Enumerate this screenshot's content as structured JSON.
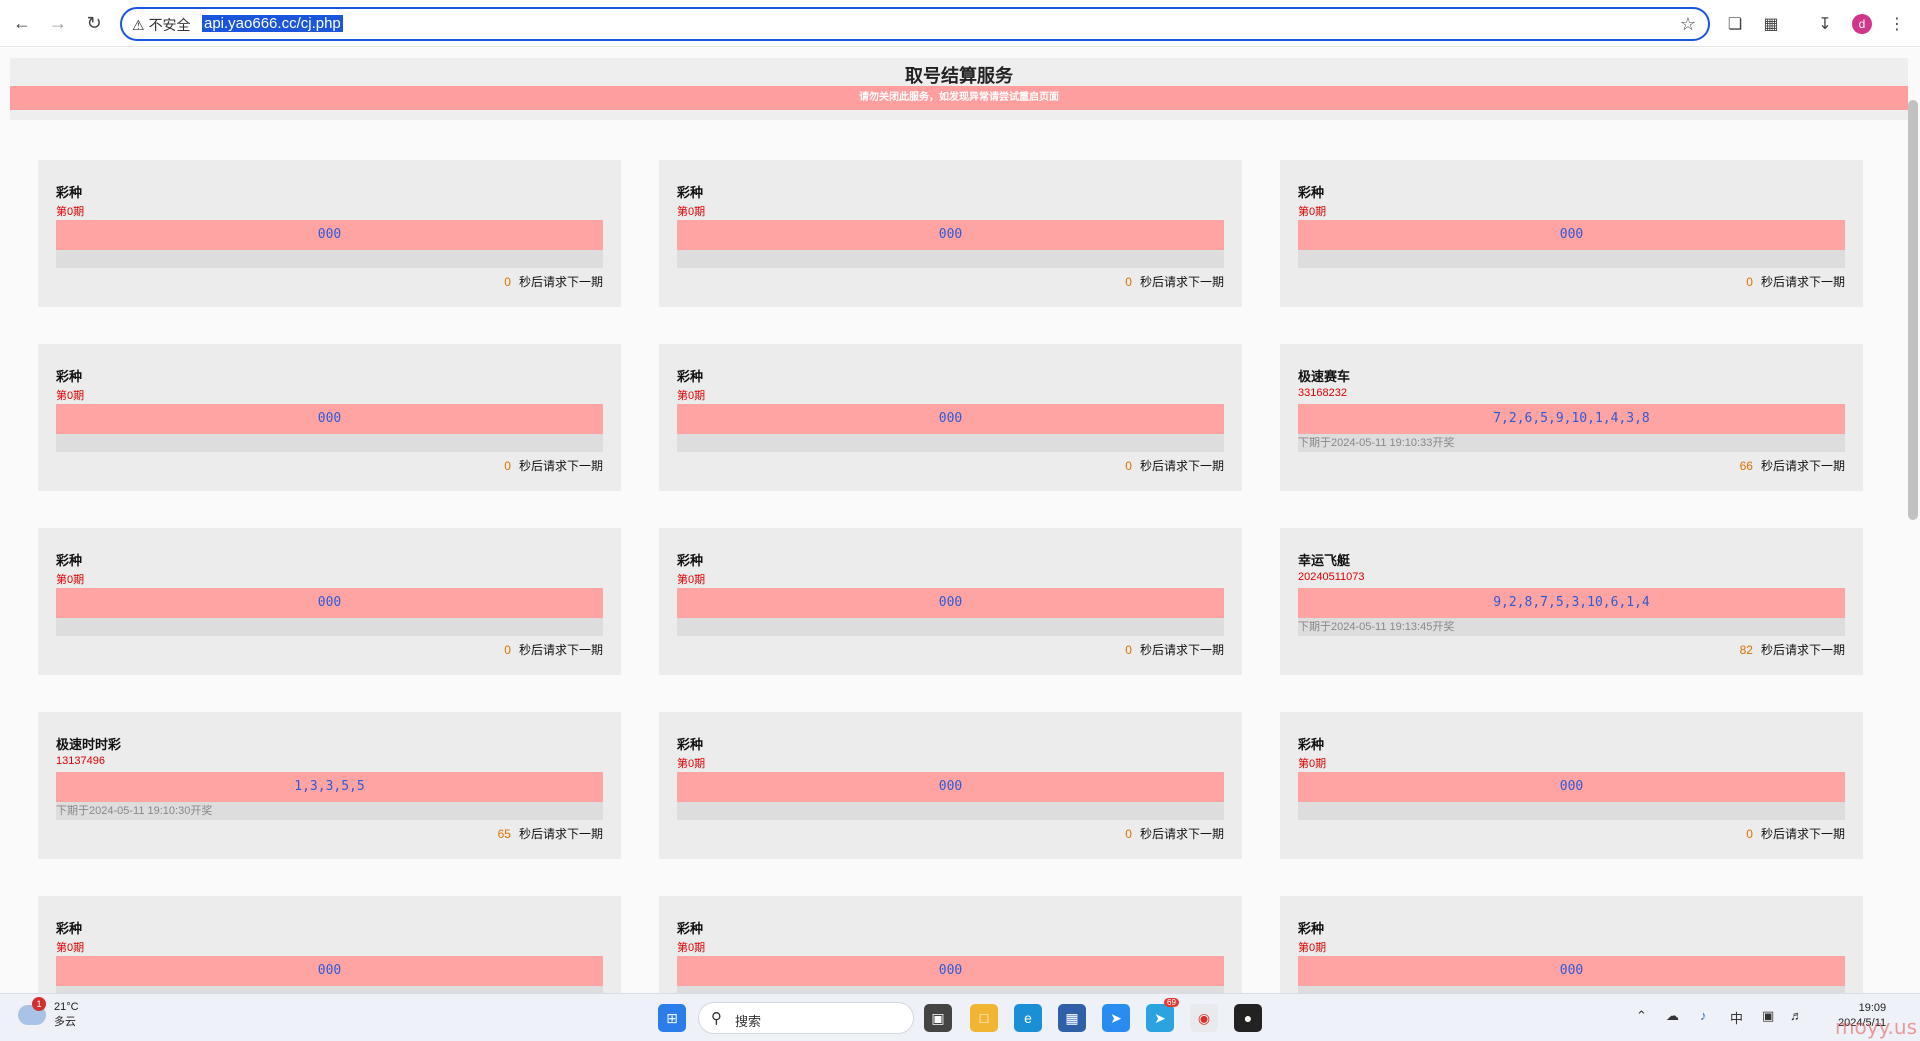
{
  "browser": {
    "security_label": "不安全",
    "url": "api.yao666.cc/cj.php",
    "profile_initial": "d"
  },
  "page": {
    "title": "取号结算服务",
    "notice": "请勿关闭此服务，如发现异常请尝试重启页面",
    "countdown_suffix": "秒后请求下一期"
  },
  "cards": [
    {
      "name": "彩种",
      "period": "第0期",
      "result": "000",
      "next": "",
      "countdown": "0"
    },
    {
      "name": "彩种",
      "period": "第0期",
      "result": "000",
      "next": "",
      "countdown": "0"
    },
    {
      "name": "彩种",
      "period": "第0期",
      "result": "000",
      "next": "",
      "countdown": "0"
    },
    {
      "name": "彩种",
      "period": "第0期",
      "result": "000",
      "next": "",
      "countdown": "0"
    },
    {
      "name": "彩种",
      "period": "第0期",
      "result": "000",
      "next": "",
      "countdown": "0"
    },
    {
      "name": "极速赛车",
      "period": "33168232",
      "result": "7,2,6,5,9,10,1,4,3,8",
      "next": "下期于2024-05-11 19:10:33开奖",
      "countdown": "66"
    },
    {
      "name": "彩种",
      "period": "第0期",
      "result": "000",
      "next": "",
      "countdown": "0"
    },
    {
      "name": "彩种",
      "period": "第0期",
      "result": "000",
      "next": "",
      "countdown": "0"
    },
    {
      "name": "幸运飞艇",
      "period": "20240511073",
      "result": "9,2,8,7,5,3,10,6,1,4",
      "next": "下期于2024-05-11 19:13:45开奖",
      "countdown": "82"
    },
    {
      "name": "极速时时彩",
      "period": "13137496",
      "result": "1,3,3,5,5",
      "next": "下期于2024-05-11 19:10:30开奖",
      "countdown": "65"
    },
    {
      "name": "彩种",
      "period": "第0期",
      "result": "000",
      "next": "",
      "countdown": "0"
    },
    {
      "name": "彩种",
      "period": "第0期",
      "result": "000",
      "next": "",
      "countdown": "0"
    },
    {
      "name": "彩种",
      "period": "第0期",
      "result": "000",
      "next": "",
      "countdown": ""
    },
    {
      "name": "彩种",
      "period": "第0期",
      "result": "000",
      "next": "",
      "countdown": ""
    },
    {
      "name": "彩种",
      "period": "第0期",
      "result": "000",
      "next": "",
      "countdown": ""
    }
  ],
  "taskbar": {
    "weather_temp": "21°C",
    "weather_desc": "多云",
    "weather_badge": "1",
    "search_label": "搜索",
    "telegram_badge": "69",
    "ime": "中",
    "time": "19:09",
    "date": "2024/5/11"
  },
  "watermark": "moyy.us"
}
